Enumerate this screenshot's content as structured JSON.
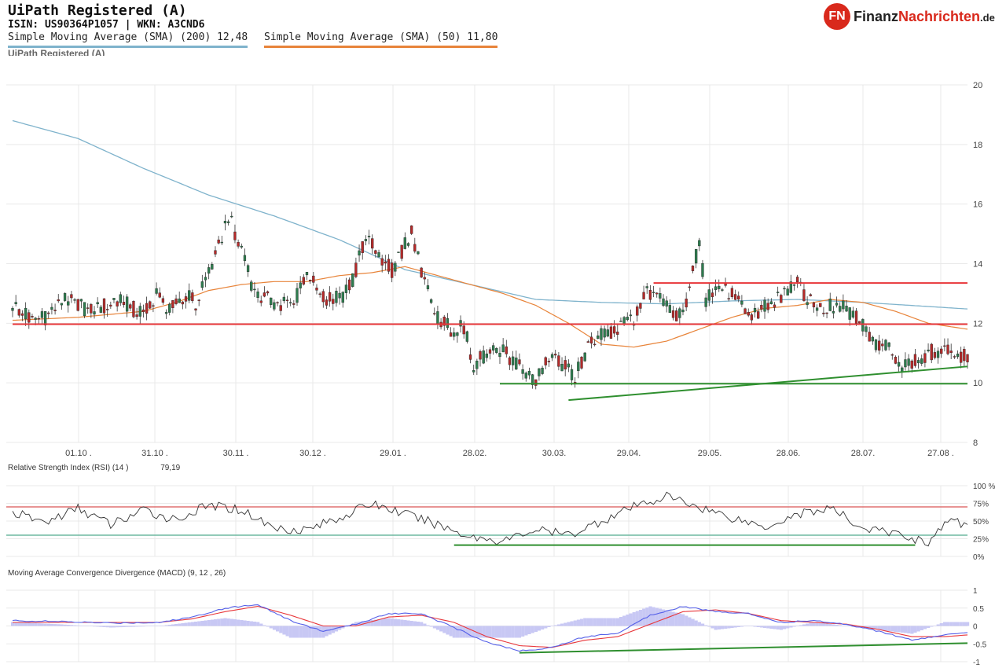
{
  "header": {
    "title": "UiPath Registered (A)",
    "isin_line": "ISIN: US90364P1057  | WKN: A3CND6",
    "legend_sma200": "Simple Moving Average (SMA) (200) 12,48",
    "legend_sma50": "Simple Moving Average (SMA) (50) 11,80",
    "faded_title": "UiPath Registered (A)"
  },
  "logo": {
    "mark": "FN",
    "part1": "Finanz",
    "part2": "Nachrichten",
    "tld": ".de"
  },
  "colors": {
    "sma200": "#7fb3cc",
    "sma50": "#e8843a",
    "up": "#2e7d4f",
    "down": "#b52a2a",
    "support_red": "#e8363a",
    "trend_green": "#2f8f2f",
    "rsi_line": "#333333",
    "rsi_upper": "#e07070",
    "rsi_lower": "#6fb8a0",
    "macd_line": "#5560e8",
    "signal_line": "#e8363a",
    "histogram": "#c8c8f4",
    "grid": "#e9e9e9"
  },
  "rsi": {
    "label": "Relative Strength Index (RSI) (14 )",
    "value_label": "79,19",
    "ticks": [
      "100 %",
      "75%",
      "50%",
      "25%",
      "0%"
    ]
  },
  "macd": {
    "label": "Moving Average Convergence Divergence (MACD) (9, 12 , 26)",
    "ticks": [
      "1",
      "0.5",
      "0",
      "-0.5",
      "-1"
    ]
  },
  "chart_data": [
    {
      "type": "candlestick",
      "title": "UiPath Registered (A)",
      "x_tick_labels": [
        "01.10 .",
        "31.10 .",
        "30.11 .",
        "30.12 .",
        "29.01 .",
        "28.02.",
        "30.03.",
        "29.04.",
        "29.05.",
        "28.06.",
        "28.07.",
        "27.08 ."
      ],
      "ylim": [
        8,
        20
      ],
      "y_ticks": [
        20,
        18,
        16,
        14,
        12,
        10,
        8
      ],
      "price_waypoints": [
        [
          0,
          12.6
        ],
        [
          6,
          12.1
        ],
        [
          10,
          12.2
        ],
        [
          16,
          12.8
        ],
        [
          24,
          12.4
        ],
        [
          32,
          12.8
        ],
        [
          40,
          12.3
        ],
        [
          44,
          13.0
        ],
        [
          48,
          12.4
        ],
        [
          54,
          13.0
        ],
        [
          56,
          12.6
        ],
        [
          62,
          14.2
        ],
        [
          66,
          15.6
        ],
        [
          70,
          14.5
        ],
        [
          74,
          13.0
        ],
        [
          80,
          12.7
        ],
        [
          86,
          12.6
        ],
        [
          90,
          13.8
        ],
        [
          94,
          12.9
        ],
        [
          100,
          12.8
        ],
        [
          104,
          13.4
        ],
        [
          108,
          15.0
        ],
        [
          112,
          14.2
        ],
        [
          116,
          13.8
        ],
        [
          122,
          15.0
        ],
        [
          126,
          13.4
        ],
        [
          130,
          12.2
        ],
        [
          134,
          11.8
        ],
        [
          138,
          11.9
        ],
        [
          141,
          10.6
        ],
        [
          146,
          11.1
        ],
        [
          150,
          11.1
        ],
        [
          156,
          10.4
        ],
        [
          160,
          10.1
        ],
        [
          164,
          10.9
        ],
        [
          168,
          10.6
        ],
        [
          172,
          10.2
        ],
        [
          176,
          11.2
        ],
        [
          180,
          11.6
        ],
        [
          186,
          11.9
        ],
        [
          190,
          12.2
        ],
        [
          194,
          13.0
        ],
        [
          198,
          12.8
        ],
        [
          202,
          12.2
        ],
        [
          206,
          12.6
        ],
        [
          210,
          14.8
        ],
        [
          212,
          12.8
        ],
        [
          216,
          13.2
        ],
        [
          220,
          13.0
        ],
        [
          224,
          12.3
        ],
        [
          228,
          12.4
        ],
        [
          232,
          12.7
        ],
        [
          236,
          13.0
        ],
        [
          240,
          13.3
        ],
        [
          244,
          12.7
        ],
        [
          248,
          12.5
        ],
        [
          252,
          12.6
        ],
        [
          256,
          12.4
        ],
        [
          260,
          11.9
        ],
        [
          264,
          11.3
        ],
        [
          268,
          11.2
        ],
        [
          272,
          10.6
        ],
        [
          276,
          10.8
        ],
        [
          280,
          11.0
        ],
        [
          284,
          11.1
        ],
        [
          288,
          11.0
        ],
        [
          292,
          10.9
        ]
      ],
      "n_candles": 293,
      "sma200": {
        "name": "Simple Moving Average (SMA) (200)",
        "waypoints": [
          [
            0,
            18.8
          ],
          [
            20,
            18.2
          ],
          [
            40,
            17.2
          ],
          [
            60,
            16.3
          ],
          [
            80,
            15.6
          ],
          [
            100,
            14.8
          ],
          [
            120,
            13.8
          ],
          [
            140,
            13.3
          ],
          [
            160,
            12.8
          ],
          [
            180,
            12.7
          ],
          [
            200,
            12.65
          ],
          [
            220,
            12.75
          ],
          [
            240,
            12.8
          ],
          [
            260,
            12.7
          ],
          [
            292,
            12.48
          ]
        ]
      },
      "sma50": {
        "name": "Simple Moving Average (SMA) (50)",
        "waypoints": [
          [
            0,
            12.1
          ],
          [
            20,
            12.2
          ],
          [
            40,
            12.4
          ],
          [
            50,
            12.7
          ],
          [
            60,
            13.1
          ],
          [
            70,
            13.3
          ],
          [
            80,
            13.4
          ],
          [
            90,
            13.4
          ],
          [
            100,
            13.6
          ],
          [
            110,
            13.7
          ],
          [
            120,
            13.9
          ],
          [
            130,
            13.6
          ],
          [
            140,
            13.3
          ],
          [
            150,
            13.0
          ],
          [
            160,
            12.6
          ],
          [
            170,
            12.0
          ],
          [
            180,
            11.3
          ],
          [
            190,
            11.2
          ],
          [
            200,
            11.4
          ],
          [
            210,
            11.8
          ],
          [
            220,
            12.2
          ],
          [
            230,
            12.5
          ],
          [
            240,
            12.6
          ],
          [
            250,
            12.8
          ],
          [
            260,
            12.7
          ],
          [
            270,
            12.4
          ],
          [
            280,
            12.0
          ],
          [
            292,
            11.8
          ]
        ]
      },
      "lines": [
        {
          "name": "resistance",
          "color": "red",
          "from": [
            0,
            11.97
          ],
          "to": [
            292,
            11.97
          ]
        },
        {
          "name": "resistance-upper",
          "color": "red",
          "from": [
            196,
            13.35
          ],
          "to": [
            292,
            13.35
          ]
        },
        {
          "name": "support",
          "color": "green",
          "from": [
            149,
            9.97
          ],
          "to": [
            292,
            9.97
          ]
        },
        {
          "name": "uptrend",
          "color": "green",
          "from": [
            170,
            9.42
          ],
          "to": [
            292,
            10.55
          ]
        }
      ]
    },
    {
      "type": "line",
      "title": "Relative Strength Index (RSI) (14 )",
      "ylim": [
        0,
        100
      ],
      "upper_band": 70,
      "lower_band": 30,
      "waypoints": [
        [
          0,
          62
        ],
        [
          10,
          48
        ],
        [
          20,
          68
        ],
        [
          30,
          45
        ],
        [
          40,
          65
        ],
        [
          50,
          52
        ],
        [
          60,
          72
        ],
        [
          70,
          66
        ],
        [
          80,
          40
        ],
        [
          90,
          38
        ],
        [
          100,
          55
        ],
        [
          110,
          75
        ],
        [
          120,
          60
        ],
        [
          130,
          45
        ],
        [
          140,
          28
        ],
        [
          150,
          22
        ],
        [
          160,
          38
        ],
        [
          170,
          30
        ],
        [
          180,
          50
        ],
        [
          190,
          70
        ],
        [
          200,
          85
        ],
        [
          210,
          70
        ],
        [
          220,
          55
        ],
        [
          230,
          42
        ],
        [
          240,
          60
        ],
        [
          250,
          68
        ],
        [
          260,
          40
        ],
        [
          270,
          32
        ],
        [
          280,
          20
        ],
        [
          286,
          50
        ],
        [
          292,
          45
        ]
      ],
      "trend_line": {
        "from": [
          135,
          16
        ],
        "to": [
          276,
          16
        ]
      }
    },
    {
      "type": "line",
      "title": "Moving Average Convergence Divergence (MACD) (9, 12 , 26)",
      "ylim": [
        -1,
        1
      ],
      "macd_waypoints": [
        [
          0,
          0.15
        ],
        [
          15,
          0.12
        ],
        [
          30,
          0.08
        ],
        [
          45,
          0.1
        ],
        [
          55,
          0.25
        ],
        [
          65,
          0.5
        ],
        [
          75,
          0.6
        ],
        [
          85,
          0.15
        ],
        [
          95,
          -0.15
        ],
        [
          105,
          0.05
        ],
        [
          115,
          0.35
        ],
        [
          125,
          0.35
        ],
        [
          135,
          -0.05
        ],
        [
          145,
          -0.45
        ],
        [
          155,
          -0.7
        ],
        [
          165,
          -0.6
        ],
        [
          175,
          -0.3
        ],
        [
          185,
          -0.2
        ],
        [
          195,
          0.3
        ],
        [
          205,
          0.55
        ],
        [
          215,
          0.4
        ],
        [
          225,
          0.35
        ],
        [
          235,
          0.1
        ],
        [
          245,
          0.15
        ],
        [
          255,
          0.05
        ],
        [
          265,
          -0.15
        ],
        [
          275,
          -0.4
        ],
        [
          285,
          -0.25
        ],
        [
          292,
          -0.2
        ]
      ],
      "signal_waypoints": [
        [
          0,
          0.1
        ],
        [
          15,
          0.1
        ],
        [
          30,
          0.1
        ],
        [
          45,
          0.1
        ],
        [
          55,
          0.2
        ],
        [
          65,
          0.4
        ],
        [
          75,
          0.55
        ],
        [
          85,
          0.3
        ],
        [
          95,
          0.0
        ],
        [
          105,
          0.0
        ],
        [
          115,
          0.25
        ],
        [
          125,
          0.3
        ],
        [
          135,
          0.1
        ],
        [
          145,
          -0.3
        ],
        [
          155,
          -0.55
        ],
        [
          165,
          -0.6
        ],
        [
          175,
          -0.4
        ],
        [
          185,
          -0.3
        ],
        [
          195,
          0.05
        ],
        [
          205,
          0.4
        ],
        [
          215,
          0.45
        ],
        [
          225,
          0.35
        ],
        [
          235,
          0.15
        ],
        [
          245,
          0.1
        ],
        [
          255,
          0.05
        ],
        [
          265,
          -0.1
        ],
        [
          275,
          -0.3
        ],
        [
          285,
          -0.3
        ],
        [
          292,
          -0.25
        ]
      ],
      "trend_line": {
        "from": [
          155,
          -0.75
        ],
        "to": [
          292,
          -0.48
        ]
      }
    }
  ]
}
